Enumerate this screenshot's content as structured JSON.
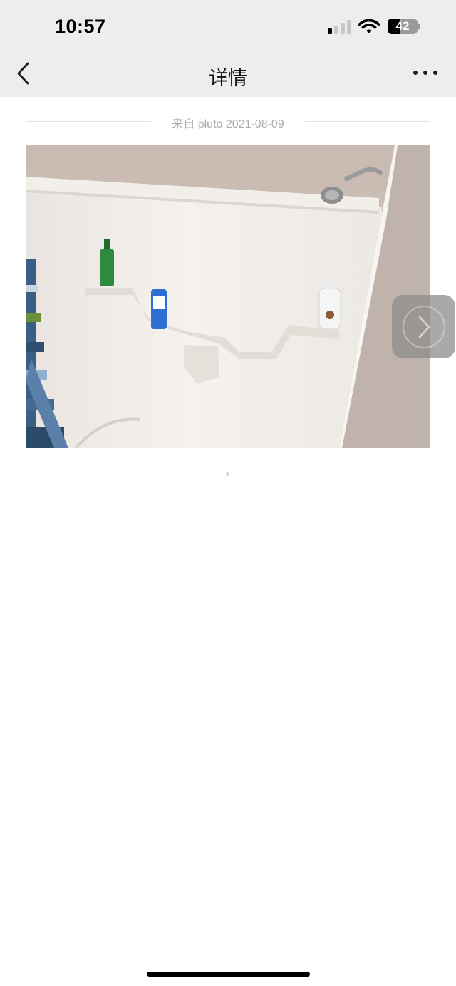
{
  "status_bar": {
    "time": "10:57",
    "battery_level": "42",
    "signal_bars_active": 1,
    "signal_bars_total": 4
  },
  "nav": {
    "back_icon": "chevron-left-icon",
    "title": "详情",
    "more_icon": "more-dots-icon"
  },
  "post": {
    "meta": "来自 pluto 2021-08-09",
    "image_subject": "shower enclosure with shelves and bottles",
    "next_icon": "chevron-right-icon"
  },
  "colors": {
    "topbar_bg": "#ededed",
    "meta_text": "#ababab",
    "divider": "#e4e4e4"
  }
}
